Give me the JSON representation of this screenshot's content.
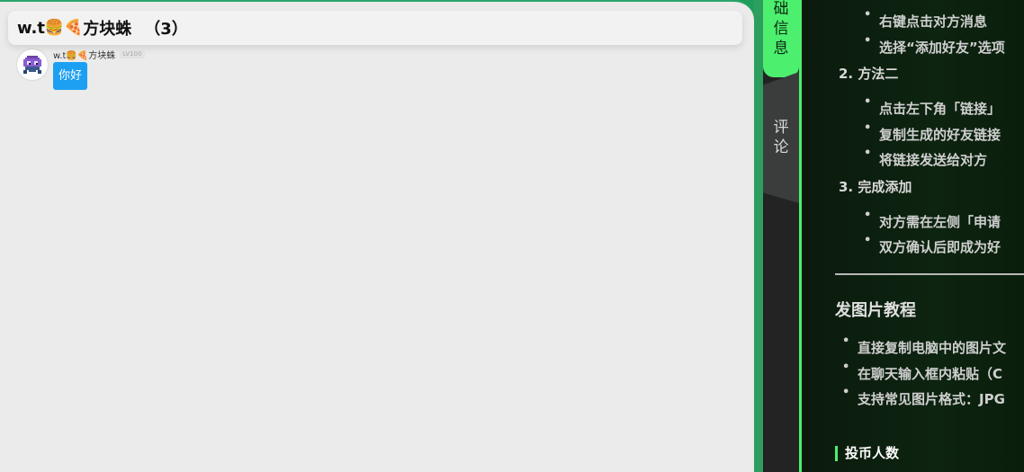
{
  "chat": {
    "title": "w.t",
    "title_emojis": "🍔🍕",
    "title_name": "方块蛛",
    "member_count": "（3）",
    "messages": [
      {
        "sender": "w.t🍔🍕方块蛛",
        "level": "LV100",
        "text": "你好"
      }
    ]
  },
  "tabs": {
    "info": "信息",
    "info_partial": "础",
    "comment_1": "评",
    "comment_2": "论"
  },
  "info": {
    "method1_items": [
      "右键点击对方消息",
      "选择“添加好友”选项"
    ],
    "method2_title": "2. 方法二",
    "method2_items": [
      "点击左下角「链接」",
      "复制生成的好友链接",
      "将链接发送给对方"
    ],
    "method3_title": "3. 完成添加",
    "method3_items": [
      "对方需在左侧「申请",
      "双方确认后即成为好"
    ],
    "image_section_title": "发图片教程",
    "image_items": [
      "直接复制电脑中的图片文",
      "在聊天输入框内粘贴（C",
      "支持常见图片格式：JPG"
    ],
    "coin_title": "投币人数"
  },
  "colors": {
    "accent_green": "#4cf06e",
    "bubble_blue": "#1ea0f2",
    "chat_bg": "#ebebeb",
    "panel_bg": "#0b1a0d"
  }
}
